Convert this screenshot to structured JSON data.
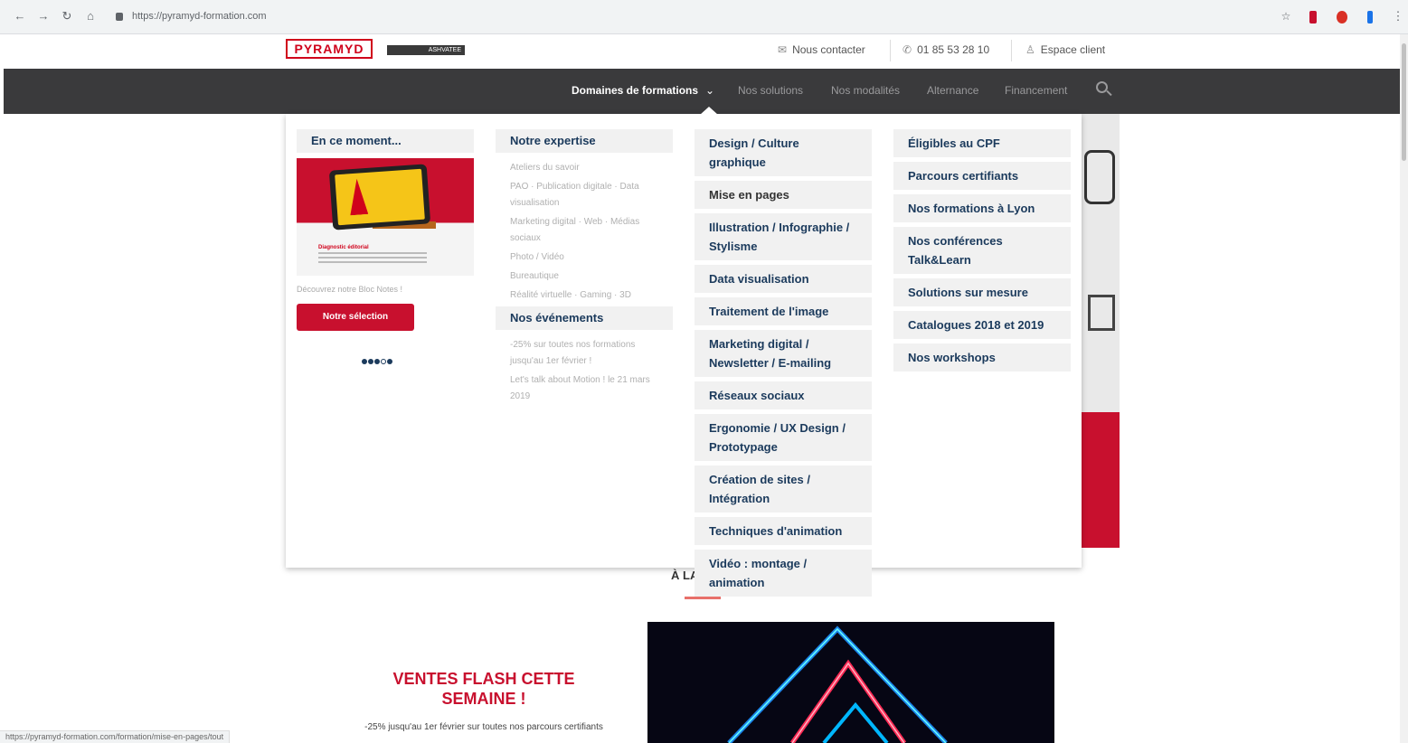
{
  "browser": {
    "url": "https://pyramyd-formation.com",
    "status_url": "https://pyramyd-formation.com/formation/mise-en-pages/tout"
  },
  "header": {
    "logo_text": "PYRAMYD",
    "logo_sub": "ASHVATEE",
    "contact_label": "Nous contacter",
    "phone": "01 85 53 28 10",
    "client_label": "Espace client"
  },
  "nav": {
    "items": [
      {
        "label": "Domaines de formations"
      },
      {
        "label": "Nos solutions"
      },
      {
        "label": "Nos modalités"
      },
      {
        "label": "Alternance"
      },
      {
        "label": "Financement"
      }
    ]
  },
  "mega": {
    "col1": {
      "heading": "En ce moment...",
      "promo_caption": "Diagnostic éditorial",
      "promo_text": "Découvrez notre Bloc Notes !",
      "button_label": "Notre sélection"
    },
    "col2": {
      "heading": "Notre expertise",
      "links": [
        "Ateliers du savoir",
        "PAO · Publication digitale · Data visualisation",
        "Marketing digital · Web · Médias sociaux",
        "Photo / Vidéo",
        "Bureautique",
        "Réalité virtuelle · Gaming · 3D"
      ],
      "events_heading": "Nos événements",
      "events": [
        "-25% sur toutes nos formations jusqu'au 1er février !",
        "Let's talk about Motion ! le 21 mars 2019"
      ]
    },
    "col3": {
      "links": [
        "Design / Culture graphique",
        "Mise en pages",
        "Illustration / Infographie / Stylisme",
        "Data visualisation",
        "Traitement de l'image",
        "Marketing digital / Newsletter / E-mailing",
        "Réseaux sociaux",
        "Ergonomie / UX Design / Prototypage",
        "Création de sites / Intégration",
        "Techniques d'animation",
        "Vidéo : montage / animation"
      ]
    },
    "col4": {
      "links": [
        "Éligibles au CPF",
        "Parcours certifiants",
        "Nos formations à Lyon",
        "Nos conférences Talk&Learn",
        "Solutions sur mesure",
        "Catalogues 2018 et 2019",
        "Nos workshops"
      ]
    }
  },
  "content": {
    "une_title": "À LA UNE",
    "flash_title": "VENTES FLASH CETTE SEMAINE !",
    "flash_sub": "-25% jusqu'au 1er février sur toutes nos parcours certifiants"
  },
  "colors": {
    "brand_red": "#c8102e",
    "nav_bg": "#3a3a3c",
    "link_blue": "#1b3a5c"
  }
}
